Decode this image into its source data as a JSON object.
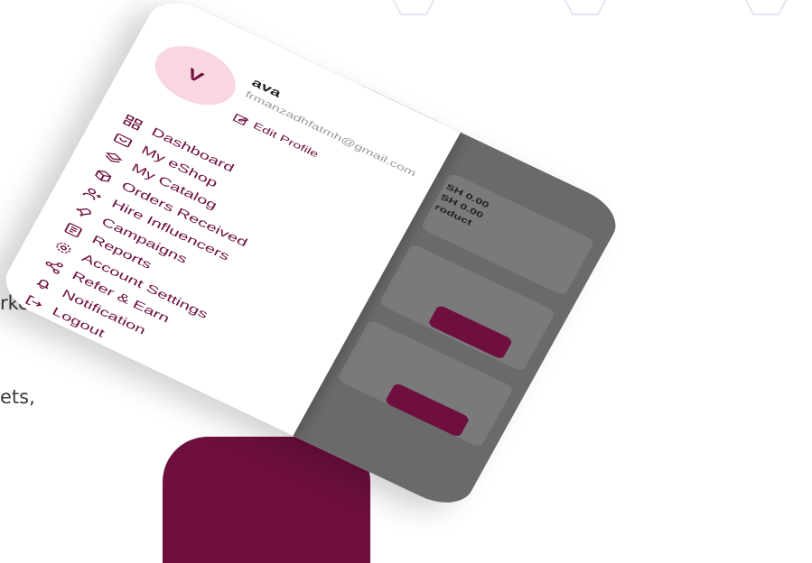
{
  "background": {
    "left_text_lines": [
      "rket",
      "ets,"
    ]
  },
  "profile": {
    "avatar_initial": "V",
    "name": "ava",
    "email": "frmanzadhfatmh@gmail.com",
    "edit_label": "Edit Profile"
  },
  "menu": [
    {
      "label": "Dashboard",
      "icon": "dashboard-icon"
    },
    {
      "label": "My eShop",
      "icon": "shop-icon"
    },
    {
      "label": "My Catalog",
      "icon": "catalog-icon"
    },
    {
      "label": "Orders Received",
      "icon": "orders-icon"
    },
    {
      "label": "Hire Influencers",
      "icon": "influencers-icon"
    },
    {
      "label": "Campaigns",
      "icon": "campaigns-icon"
    },
    {
      "label": "Reports",
      "icon": "reports-icon"
    },
    {
      "label": "Account Settings",
      "icon": "settings-icon"
    },
    {
      "label": "Refer & Earn",
      "icon": "share-icon"
    },
    {
      "label": "Notification",
      "icon": "bell-icon"
    },
    {
      "label": "Logout",
      "icon": "logout-icon"
    }
  ],
  "behind": {
    "price_1": "SH 0.00",
    "price_2": "SH 0.00",
    "product_label": "roduct"
  },
  "colors": {
    "accent": "#6e0f3f",
    "avatar_bg": "#f8d7e0",
    "overlay": "#6a6a6a"
  }
}
